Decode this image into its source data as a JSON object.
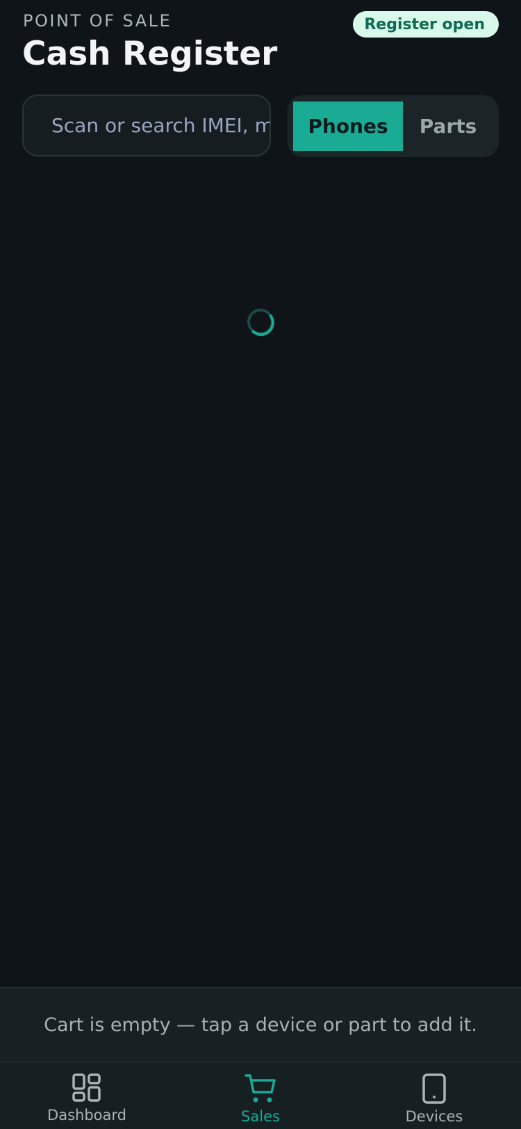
{
  "header": {
    "eyebrow": "POINT OF SALE",
    "title": "Cash Register",
    "status_badge": "Register open"
  },
  "search": {
    "placeholder": "Scan or search IMEI, model"
  },
  "segmented": {
    "options": [
      {
        "label": "Phones",
        "selected": true
      },
      {
        "label": "Parts",
        "selected": false
      }
    ]
  },
  "cart": {
    "empty_message": "Cart is empty — tap a device or part to add it."
  },
  "bottom_nav": {
    "items": [
      {
        "label": "Dashboard",
        "icon": "grid-icon",
        "active": false
      },
      {
        "label": "Sales",
        "icon": "cart-icon",
        "active": true
      },
      {
        "label": "Devices",
        "icon": "phone-icon",
        "active": false
      }
    ]
  },
  "colors": {
    "background": "#0e1417",
    "accent": "#1aab95",
    "badge_bg": "#d8f8e9",
    "badge_text": "#0f6b55"
  }
}
